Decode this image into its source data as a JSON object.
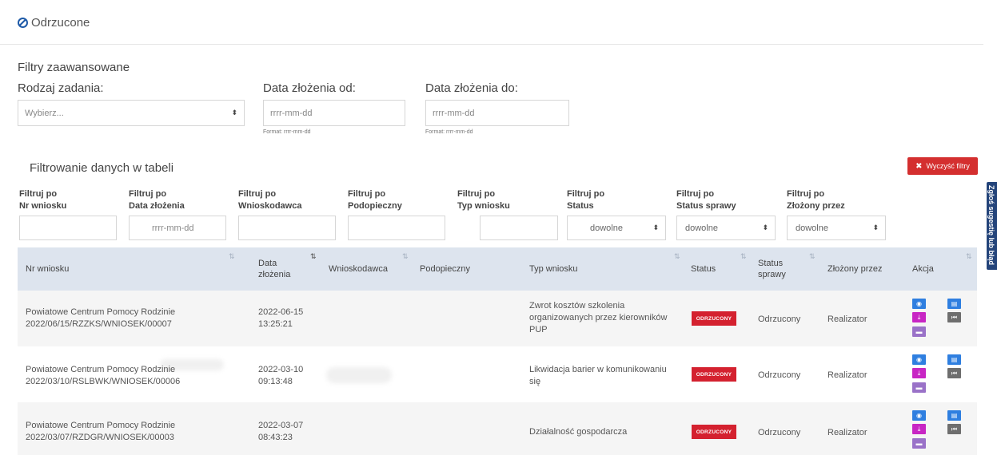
{
  "page": {
    "title": "Odrzucone"
  },
  "advanced_filters": {
    "title": "Filtry zaawansowane",
    "task_type_label": "Rodzaj zadania:",
    "task_type_value": "Wybierz...",
    "date_from_label": "Data złożenia od:",
    "date_from_placeholder": "rrrr-mm-dd",
    "date_from_hint": "Format: rrrr-mm-dd",
    "date_to_label": "Data złożenia do:",
    "date_to_placeholder": "rrrr-mm-dd",
    "date_to_hint": "Format: rrrr-mm-dd"
  },
  "table_filters": {
    "title": "Filtrowanie danych w tabeli",
    "clear_button": "Wyczyść filtry",
    "labels": [
      {
        "line1": "Filtruj po",
        "line2": "Nr wniosku"
      },
      {
        "line1": "Filtruj po",
        "line2": "Data złożenia"
      },
      {
        "line1": "Filtruj po",
        "line2": "Wnioskodawca"
      },
      {
        "line1": "Filtruj po",
        "line2": "Podopieczny"
      },
      {
        "line1": "Filtruj po",
        "line2": "Typ wniosku"
      },
      {
        "line1": "Filtruj po",
        "line2": "Status"
      },
      {
        "line1": "Filtruj po",
        "line2": "Status sprawy"
      },
      {
        "line1": "Filtruj po",
        "line2": "Złożony przez"
      }
    ],
    "date_placeholder": "rrrr-mm-dd",
    "status_value": "dowolne",
    "case_status_value": "dowolne",
    "submitted_by_value": "dowolne"
  },
  "table": {
    "headers": {
      "nr": "Nr wniosku",
      "date_line1": "Data",
      "date_line2": "złożenia",
      "applicant": "Wnioskodawca",
      "ward": "Podopieczny",
      "type": "Typ wniosku",
      "status": "Status",
      "case_line1": "Status",
      "case_line2": "sprawy",
      "by": "Złożony przez",
      "action": "Akcja"
    },
    "rows": [
      {
        "nr_line1": "Powiatowe Centrum Pomocy Rodzinie",
        "nr_line2": "2022/06/15/RZZKS/WNIOSEK/00007",
        "date": "2022-06-15",
        "time": "13:25:21",
        "type_line1": "Zwrot kosztów szkolenia",
        "type_line2": "organizowanych przez kierowników",
        "type_line3": "PUP",
        "status": "ODRZUCONY",
        "case_status": "Odrzucony",
        "by": "Realizator"
      },
      {
        "nr_line1": "Powiatowe Centrum Pomocy Rodzinie",
        "nr_line2": "2022/03/10/RSLBWK/WNIOSEK/00006",
        "date": "2022-03-10",
        "time": "09:13:48",
        "type_line1": "Likwidacja barier w komunikowaniu",
        "type_line2": "się",
        "type_line3": "",
        "status": "ODRZUCONY",
        "case_status": "Odrzucony",
        "by": "Realizator"
      },
      {
        "nr_line1": "Powiatowe Centrum Pomocy Rodzinie",
        "nr_line2": "2022/03/07/RZDGR/WNIOSEK/00003",
        "date": "2022-03-07",
        "time": "08:43:23",
        "type_line1": "Działalność gospodarcza",
        "type_line2": "",
        "type_line3": "",
        "status": "ODRZUCONY",
        "case_status": "Odrzucony",
        "by": "Realizator"
      }
    ]
  },
  "side_tab": {
    "label": "Zgłoś sugestię lub błąd"
  },
  "colors": {
    "accent_blue": "#2f7fe0",
    "danger_red": "#d42f2f",
    "badge_red": "#d4212f",
    "header_bg": "#dde4ee",
    "download_magenta": "#c826c4",
    "archive_purple": "#9a72c8",
    "back_gray": "#6e6e6e",
    "side_tab_navy": "#24447a"
  },
  "icons": {
    "title": "ban-icon",
    "clear": "times-icon",
    "sort": "sort-icon",
    "view": "eye-icon",
    "details": "list-icon",
    "download": "download-icon",
    "back": "fast-backward-icon",
    "archive": "archive-icon"
  }
}
